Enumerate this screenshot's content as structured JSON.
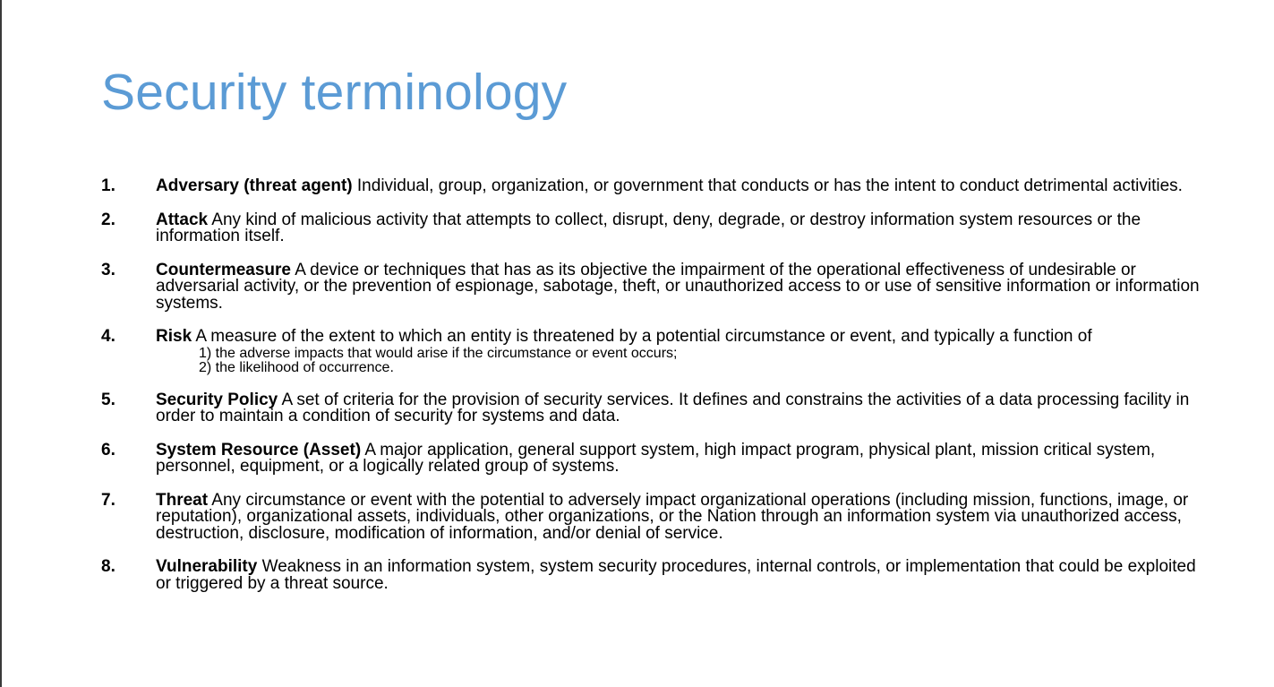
{
  "title": "Security terminology",
  "colors": {
    "title": "#5b9bd5",
    "text": "#000000",
    "background": "#ffffff"
  },
  "terms": [
    {
      "number": "1.",
      "name": "Adversary (threat agent)",
      "definition": " Individual, group, organization, or government that conducts or has the intent to conduct detrimental activities."
    },
    {
      "number": "2.",
      "name": "Attack",
      "definition": " Any kind of malicious activity that attempts to collect, disrupt, deny, degrade, or destroy information system resources or the information itself."
    },
    {
      "number": "3.",
      "name": "Countermeasure",
      "definition": " A device or techniques that has as its objective the impairment of the operational effectiveness of undesirable or adversarial activity, or the prevention of espionage, sabotage, theft, or unauthorized access to or use of sensitive information or information systems."
    },
    {
      "number": "4.",
      "name": "Risk",
      "definition": "  A measure of the extent to which an entity is threatened by a potential circumstance or event, and typically a function of",
      "sub_items": [
        "1) the adverse impacts that would arise if the circumstance or event occurs;",
        "2) the likelihood of occurrence."
      ]
    },
    {
      "number": "5.",
      "name": "Security Policy",
      "definition": " A set of criteria for the provision of security services. It defines and constrains the activities of a data processing facility in order to maintain a condition of security for systems and data."
    },
    {
      "number": "6.",
      "name": "System Resource (Asset)",
      "definition": " A major application, general support system, high impact program, physical plant, mission critical system, personnel, equipment, or a logically related group of systems."
    },
    {
      "number": "7.",
      "name": "Threat",
      "definition": " Any circumstance or event with the potential to adversely impact organizational operations (including mission, functions, image, or reputation), organizational assets, individuals, other organizations, or the Nation through an information system via unauthorized access, destruction, disclosure, modification of information, and/or denial of service."
    },
    {
      "number": "8.",
      "name": "Vulnerability",
      "definition": " Weakness in an information system, system security procedures, internal controls, or implementation that could be exploited or triggered by a threat source."
    }
  ]
}
